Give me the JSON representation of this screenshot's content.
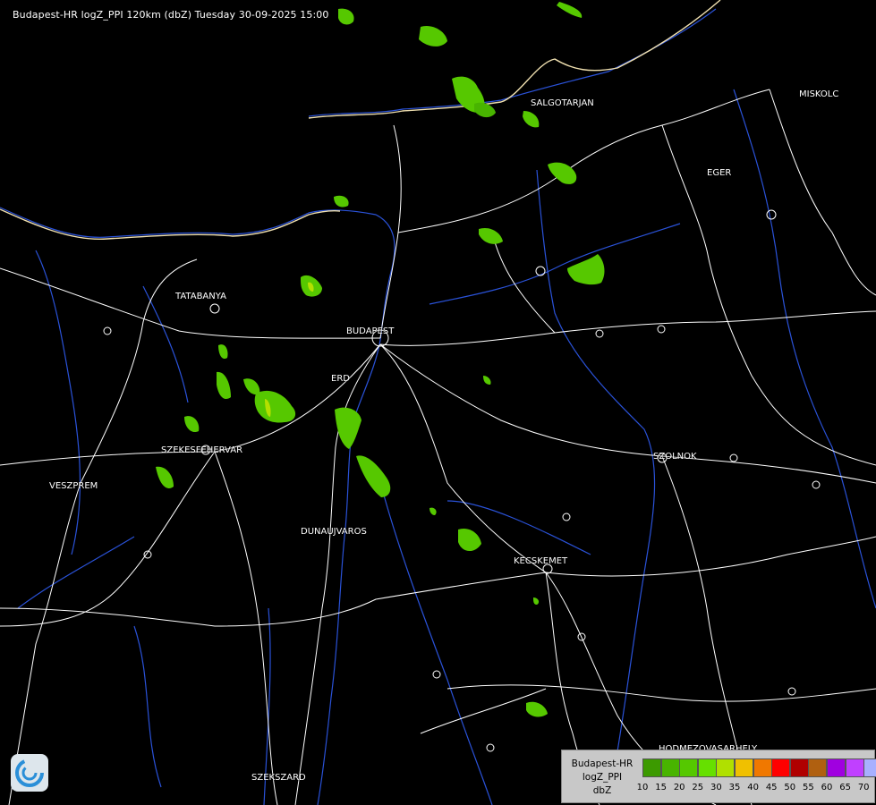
{
  "title": "Budapest-HR logZ_PPI 120km (dbZ) Tuesday 30-09-2025 15:00",
  "cities": [
    {
      "name": "SALGOTARJAN"
    },
    {
      "name": "EGER"
    },
    {
      "name": "TATABANYA"
    },
    {
      "name": "BUDAPEST"
    },
    {
      "name": "ERD"
    },
    {
      "name": "SZEKESFEHERVAR"
    },
    {
      "name": "VESZPREM"
    },
    {
      "name": "SZOLNOK"
    },
    {
      "name": "DUNAUJVAROS"
    },
    {
      "name": "KECSKEMET"
    },
    {
      "name": "HODMEZOVASARHELY"
    },
    {
      "name": "SZEKSZARD"
    },
    {
      "name": "MISKOLC"
    }
  ],
  "legend": {
    "line1": "Budapest-HR",
    "line2": "logZ_PPI",
    "line3": "dbZ",
    "ticks": [
      "10",
      "15",
      "20",
      "25",
      "30",
      "35",
      "40",
      "45",
      "50",
      "55",
      "60",
      "65",
      "70"
    ],
    "colors": [
      "#3c9a00",
      "#48b400",
      "#55c800",
      "#66e000",
      "#b0e000",
      "#f0c000",
      "#f07800",
      "#ff0000",
      "#b00000",
      "#b06010",
      "#a000e0",
      "#c040ff",
      "#a8b0ff"
    ]
  },
  "colors": {
    "background": "#000000",
    "roads": "#ffffff",
    "rivers": "#2a52d8",
    "echo_light": "#56c800",
    "echo_strong": "#b4e000"
  }
}
